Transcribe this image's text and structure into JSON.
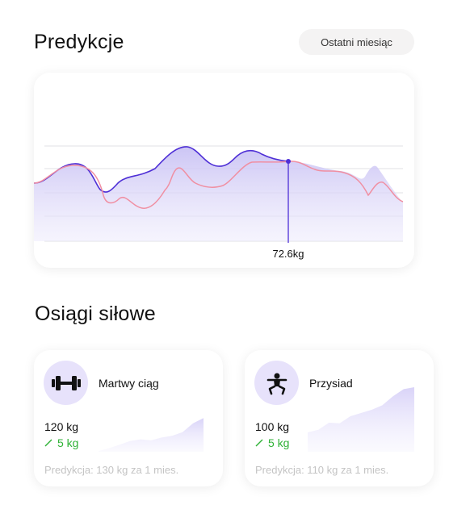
{
  "header": {
    "title": "Predykcje",
    "period": "Ostatni miesiąc"
  },
  "chart": {
    "value_label": "72.6kg"
  },
  "chart_data": {
    "type": "area",
    "title": "",
    "marker_value": "72.6kg",
    "series": [
      {
        "color": "#4e2fd6",
        "fill": "#c9c2f4",
        "values": [
          0.62,
          0.68,
          0.83,
          0.78,
          0.57,
          0.66,
          0.72,
          0.84,
          0.99,
          0.77,
          0.74,
          0.88,
          0.86,
          0.79,
          0.79
        ]
      },
      {
        "color": "#f08fa2",
        "values": [
          0.59,
          0.67,
          0.81,
          0.71,
          0.46,
          0.43,
          0.56,
          0.73,
          0.61,
          0.74,
          0.82,
          0.8,
          0.79,
          0.69,
          0.54,
          0.6,
          0.47
        ]
      }
    ]
  },
  "section": {
    "title": "Osiągi siłowe"
  },
  "cards": [
    {
      "name": "Martwy ciąg",
      "icon": "dumbbell-icon",
      "weight": "120 kg",
      "delta": "5 kg",
      "prediction": "Predykcja: 130 kg za 1 mies.",
      "spark": [
        0.02,
        0.1,
        0.2,
        0.3,
        0.35,
        0.32,
        0.4,
        0.45,
        0.55,
        0.8,
        0.95
      ]
    },
    {
      "name": "Przysiad",
      "icon": "squat-icon",
      "weight": "100 kg",
      "delta": "5 kg",
      "prediction": "Predykcja: 110 kg za 1 mies.",
      "spark": [
        0.3,
        0.34,
        0.45,
        0.44,
        0.55,
        0.6,
        0.65,
        0.72,
        0.86,
        0.97,
        1.0
      ]
    }
  ],
  "colors": {
    "accent": "#4e2fd6",
    "accent_fill": "#e7e2fb",
    "prediction_line": "#f08fa2",
    "positive": "#2fb236"
  }
}
